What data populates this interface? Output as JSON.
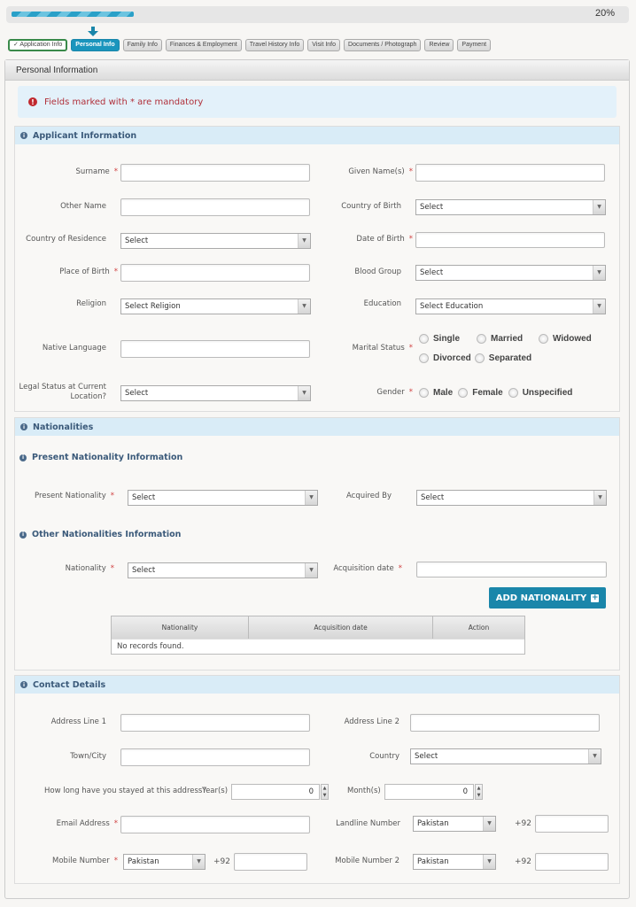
{
  "progress": {
    "value_percent": 20,
    "label": "20%"
  },
  "steps": [
    {
      "label": "✓ Application Info",
      "state": "done"
    },
    {
      "label": "Personal Info",
      "state": "active"
    },
    {
      "label": "Family Info",
      "state": "pending"
    },
    {
      "label": "Finances & Employment",
      "state": "pending"
    },
    {
      "label": "Travel History Info",
      "state": "pending"
    },
    {
      "label": "Visit Info",
      "state": "pending"
    },
    {
      "label": "Documents / Photograph",
      "state": "pending"
    },
    {
      "label": "Review",
      "state": "pending"
    },
    {
      "label": "Payment",
      "state": "pending"
    }
  ],
  "panel": {
    "title": "Personal Information"
  },
  "alert": {
    "text": "Fields marked with  * are mandatory",
    "icon": "exclamation-icon"
  },
  "applicant": {
    "title": "Applicant Information",
    "surname": {
      "label": "Surname",
      "required": "*",
      "value": ""
    },
    "given_names": {
      "label": "Given Name(s)",
      "required": "*",
      "value": ""
    },
    "other_name": {
      "label": "Other Name",
      "value": ""
    },
    "country_of_birth": {
      "label": "Country of Birth",
      "selected": "Select"
    },
    "country_of_residence": {
      "label": "Country of Residence",
      "selected": "Select"
    },
    "date_of_birth": {
      "label": "Date of Birth",
      "required": "*",
      "value": ""
    },
    "place_of_birth": {
      "label": "Place of Birth",
      "required": "*",
      "value": ""
    },
    "blood_group": {
      "label": "Blood Group",
      "selected": "Select"
    },
    "religion": {
      "label": "Religion",
      "selected": "Select Religion"
    },
    "education": {
      "label": "Education",
      "selected": "Select Education"
    },
    "native_language": {
      "label": "Native Language",
      "value": ""
    },
    "marital_status": {
      "label": "Marital Status",
      "required": "*",
      "options": [
        "Single",
        "Married",
        "Widowed",
        "Divorced",
        "Separated"
      ]
    },
    "legal_status": {
      "label": "Legal Status at Current Location?",
      "selected": "Select"
    },
    "gender": {
      "label": "Gender",
      "required": "*",
      "options": [
        "Male",
        "Female",
        "Unspecified"
      ]
    }
  },
  "nationalities": {
    "title": "Nationalities",
    "present_title": "Present Nationality Information",
    "present_nationality": {
      "label": "Present Nationality",
      "required": "*",
      "selected": "Select"
    },
    "acquired_by": {
      "label": "Acquired By",
      "selected": "Select"
    },
    "other_title": "Other Nationalities Information",
    "nationality": {
      "label": "Nationality",
      "required": "*",
      "selected": "Select"
    },
    "acquisition_date": {
      "label": "Acquisition date",
      "required": "*",
      "value": ""
    },
    "add_button": "ADD NATIONALITY",
    "table": {
      "columns": [
        "Nationality",
        "Acquisition date",
        "Action"
      ],
      "empty_text": "No records found."
    }
  },
  "contact": {
    "title": "Contact Details",
    "address1": {
      "label": "Address Line 1",
      "value": ""
    },
    "address2": {
      "label": "Address Line 2",
      "value": ""
    },
    "town": {
      "label": "Town/City",
      "value": ""
    },
    "country": {
      "label": "Country",
      "selected": "Select"
    },
    "stay_question": "How long have you stayed at this address?",
    "years": {
      "label": "Year(s)",
      "value": "0"
    },
    "months": {
      "label": "Month(s)",
      "value": "0"
    },
    "email": {
      "label": "Email Address",
      "required": "*",
      "value": ""
    },
    "landline": {
      "label": "Landline Number",
      "country": "Pakistan",
      "prefix": "+92",
      "value": ""
    },
    "mobile": {
      "label": "Mobile Number",
      "required": "*",
      "country": "Pakistan",
      "prefix": "+92",
      "value": ""
    },
    "mobile2": {
      "label": "Mobile Number 2",
      "country": "Pakistan",
      "prefix": "+92",
      "value": ""
    }
  }
}
